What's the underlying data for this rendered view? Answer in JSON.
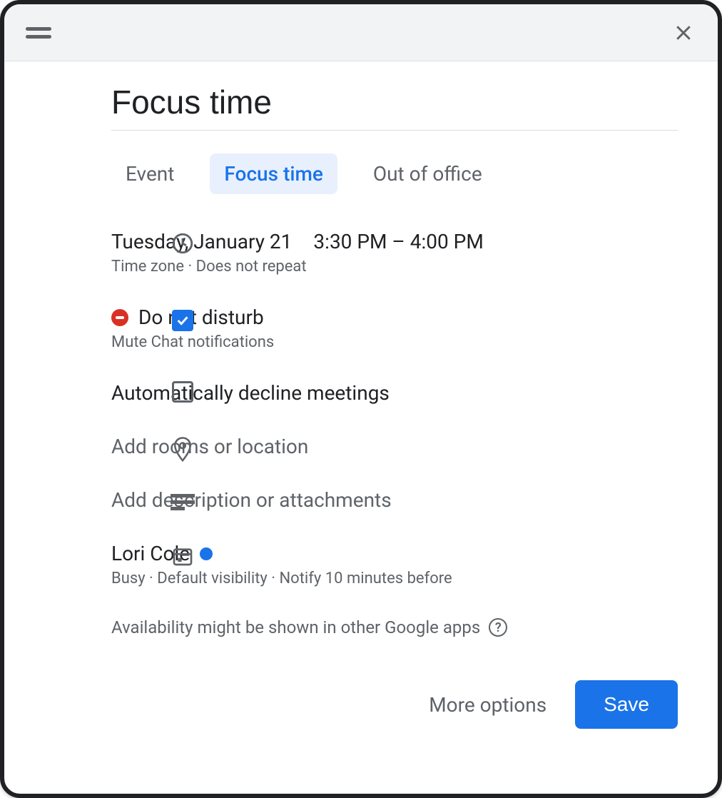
{
  "title": "Focus time",
  "tabs": {
    "event": "Event",
    "focus": "Focus time",
    "ooo": "Out of office"
  },
  "datetime": {
    "date": "Tuesday, January 21",
    "time": "3:30 PM – 4:00 PM",
    "sub": "Time zone · Does not repeat"
  },
  "dnd": {
    "title": "Do not disturb",
    "sub": "Mute Chat notifications"
  },
  "autoDecline": "Automatically decline meetings",
  "location": "Add rooms or location",
  "description": "Add description or attachments",
  "organizer": {
    "name": "Lori Cole",
    "sub": "Busy · Default visibility · Notify 10 minutes before"
  },
  "availabilityNote": "Availability might be shown in other Google apps",
  "footer": {
    "more": "More options",
    "save": "Save"
  }
}
